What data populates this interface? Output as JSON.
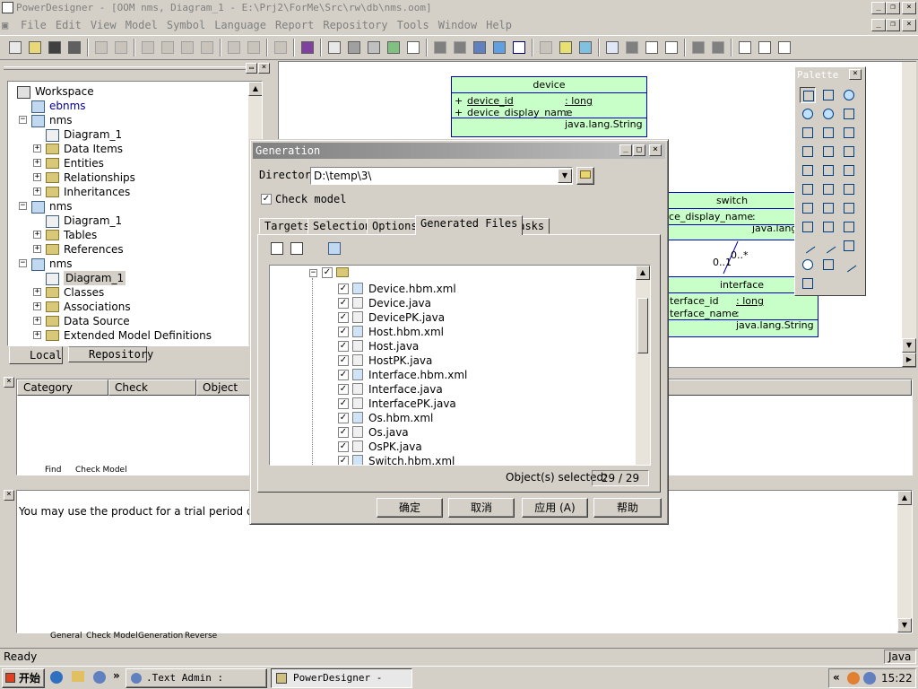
{
  "window": {
    "title": "PowerDesigner - [OOM nms, Diagram_1 - E:\\Prj2\\ForMe\\Src\\rw\\db\\nms.oom]"
  },
  "menu": [
    "File",
    "Edit",
    "View",
    "Model",
    "Symbol",
    "Language",
    "Report",
    "Repository",
    "Tools",
    "Window",
    "Help"
  ],
  "tree": {
    "items": [
      {
        "label": "Workspace",
        "icon": "workspace-icon"
      },
      {
        "label": "ebnms",
        "icon": "model-icon"
      },
      {
        "label": "nms",
        "icon": "model-icon"
      },
      {
        "label": "Diagram_1",
        "icon": "diagram-icon"
      },
      {
        "label": "Data Items",
        "icon": "folder-icon"
      },
      {
        "label": "Entities",
        "icon": "folder-icon"
      },
      {
        "label": "Relationships",
        "icon": "folder-icon"
      },
      {
        "label": "Inheritances",
        "icon": "folder-icon"
      },
      {
        "label": "nms",
        "icon": "model-icon"
      },
      {
        "label": "Diagram_1",
        "icon": "diagram-icon"
      },
      {
        "label": "Tables",
        "icon": "folder-icon"
      },
      {
        "label": "References",
        "icon": "folder-icon"
      },
      {
        "label": "nms",
        "icon": "model-icon"
      },
      {
        "label": "Diagram_1",
        "icon": "diagram-icon"
      },
      {
        "label": "Classes",
        "icon": "folder-icon"
      },
      {
        "label": "Associations",
        "icon": "folder-icon"
      },
      {
        "label": "Data Source",
        "icon": "folder-icon"
      },
      {
        "label": "Extended Model Definitions",
        "icon": "folder-icon"
      }
    ],
    "tab_local": "Local",
    "tab_repository": "Repository"
  },
  "result_list": {
    "columns": [
      "Category",
      "Check",
      "Object"
    ],
    "tabs": [
      "Find",
      "Check Model"
    ]
  },
  "output": {
    "message": "You may use the product for a trial period of 9 days.",
    "tabs": [
      "General",
      "Check Model",
      "Generation",
      "Reverse"
    ]
  },
  "diagram": {
    "device": {
      "name": "device",
      "attrs": [
        {
          "vis": "+",
          "name": "device_id",
          "type": ": long"
        },
        {
          "vis": "+",
          "name": "device_display_name",
          "type": ": java.lang.String"
        }
      ]
    },
    "switch": {
      "name": "switch",
      "attr": "ice_display_name",
      "type": ": java.lang"
    },
    "interface": {
      "name": "interface",
      "attrs": [
        {
          "name": "terface_id",
          "type": ": long"
        },
        {
          "name": "terface_name",
          "type": ": java.lang.String"
        }
      ]
    },
    "mult1": "0..1",
    "mult2": "0..*"
  },
  "palette": {
    "title": "Palette"
  },
  "dialog": {
    "title": "Generation",
    "director_label": "Director:",
    "director_value": "D:\\temp\\3\\",
    "check_model": "Check model",
    "tabs": [
      "Targets",
      "Selection",
      "Options",
      "Generated Files",
      "Tasks"
    ],
    "files": [
      "Device.hbm.xml",
      "Device.java",
      "DevicePK.java",
      "Host.hbm.xml",
      "Host.java",
      "HostPK.java",
      "Interface.hbm.xml",
      "Interface.java",
      "InterfacePK.java",
      "Os.hbm.xml",
      "Os.java",
      "OsPK.java",
      "Switch.hbm.xml"
    ],
    "selected_label": "Object(s) selected:",
    "selected_value": "29 / 29",
    "btn_ok": "确定",
    "btn_cancel": "取消",
    "btn_apply": "应用 (A)",
    "btn_help": "帮助"
  },
  "status": {
    "left": "Ready",
    "right": "Java"
  },
  "taskbar": {
    "start": "开始",
    "task1": ".Text Admin : Editi...",
    "task2": "PowerDesigner - [00...",
    "time": "15:22",
    "chevron": "»",
    "tray_chevron": "«"
  }
}
